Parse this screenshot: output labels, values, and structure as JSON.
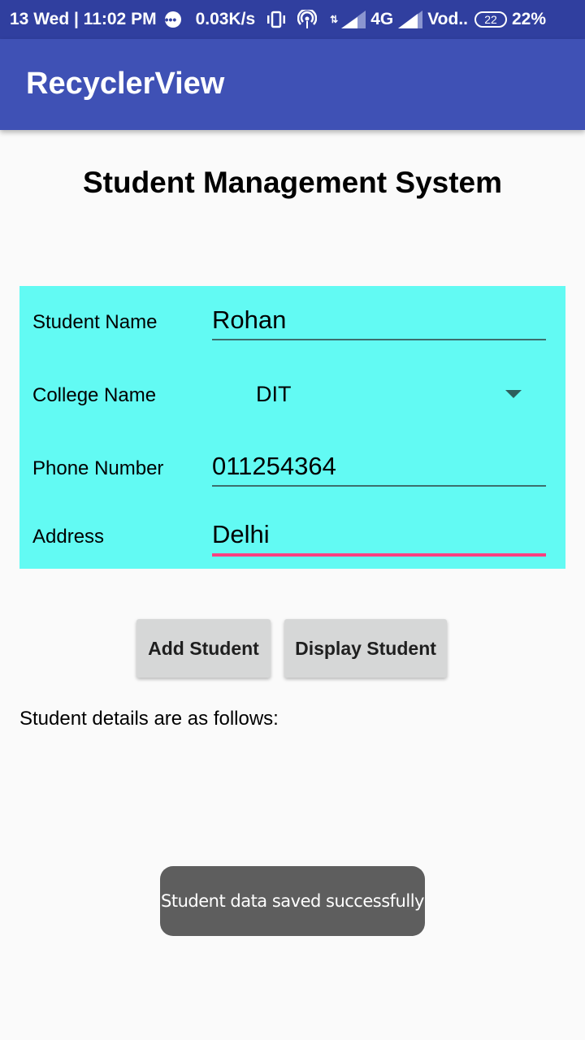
{
  "status_bar": {
    "time": "13 Wed | 11:02 PM",
    "speed": "0.03K/s",
    "network": "4G",
    "carrier": "Vod..",
    "battery_level": "22",
    "battery_percent": "22%",
    "icons": [
      "more-dots-icon",
      "vibrate-icon",
      "hotspot-icon",
      "data-arrows-icon",
      "signal-icon",
      "battery-icon"
    ]
  },
  "toolbar": {
    "title": "RecyclerView",
    "color": "#3f51b5",
    "status_color": "#303f9f"
  },
  "page": {
    "title": "Student Management System",
    "background": "#fafafa"
  },
  "form": {
    "background": "#62faf3",
    "student_name": {
      "label": "Student Name",
      "value": "Rohan"
    },
    "college_name": {
      "label": "College Name",
      "value": "DIT"
    },
    "phone_number": {
      "label": "Phone Number",
      "value": "011254364"
    },
    "address": {
      "label": "Address",
      "value": "Delhi"
    },
    "focus_color": "#ff4081"
  },
  "buttons": {
    "add_label": "Add Student",
    "display_label": "Display Student"
  },
  "details_text": "Student details are as follows:",
  "toast": {
    "message": "Student data saved successfully"
  }
}
